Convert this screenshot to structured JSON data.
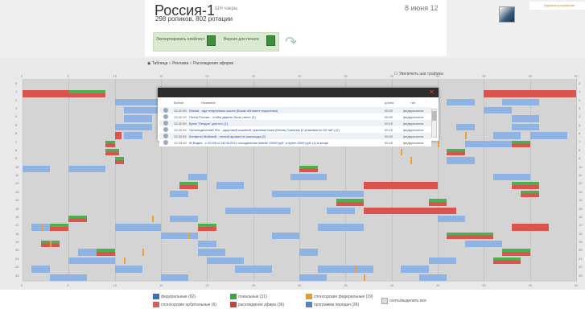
{
  "header": {
    "channel_title": "Россия-1",
    "channel_sup": "ШН чакры",
    "subtitle": "298 роликов, 802 ротации",
    "date": "8 июня  12",
    "export_label": "Экспортировать плейлист",
    "print_label": "Версия для печати",
    "admin_label": "Администрирование"
  },
  "view": {
    "option_table": "Таблица",
    "option_ads": "Реклама",
    "option_diverge": "Расхождения эфиров",
    "zoom_label": "Увеличить шаг графика"
  },
  "axis": {
    "ticks": [
      "0",
      "5",
      "10",
      "15",
      "20",
      "25",
      "30",
      "35",
      "40",
      "45",
      "50",
      "55",
      "60"
    ],
    "rows": [
      "0",
      "1",
      "2",
      "3",
      "4",
      "5",
      "6",
      "7",
      "8",
      "9",
      "10",
      "11",
      "12",
      "13",
      "14",
      "15",
      "16",
      "17",
      "18",
      "19",
      "20",
      "21",
      "22",
      "23"
    ]
  },
  "popup": {
    "headers": {
      "time": "Время",
      "title": "Название",
      "duration": "длина",
      "type": "тип"
    },
    "rows": [
      {
        "time": "12:31:59",
        "title": "Kitekat - еда энергичных кошек (Басик обгоняет поросенка)",
        "duration": "00:20",
        "type": "федеральное"
      },
      {
        "time": "12:32:19",
        "title": "Почта России - чтобы дарить было легче (2)",
        "duration": "00:20",
        "type": "федеральное"
      },
      {
        "time": "12:32:39",
        "title": "Крем \"Лендис\" для ног (1)",
        "duration": "00:10",
        "type": "федеральное"
      },
      {
        "time": "12:32:49",
        "title": "Ортопедический Яго - здоровый кошачий, красивая кожа (Месяц Граната) (2 упаковки по 60 таб.) (2)",
        "duration": "00:15",
        "type": "федеральное"
      },
      {
        "time": "12:32:59",
        "title": "Конфеты Майский - легкий аромат из шоколада (2)",
        "duration": "00:20",
        "type": "федеральное"
      },
      {
        "time": "12:33:19",
        "title": "Ж.Видео - с 29.05 по 18.06.2012 холодильник Indesit 12990 руб. и купон 3000 руб. (1) в конце",
        "duration": "00:15",
        "type": "федеральное"
      }
    ]
  },
  "legend": {
    "federal": "федеральные (62)",
    "local": "локальные (31)",
    "sponsor_fed": "спонсорские федеральные (19)",
    "sponsor_orb": "спонсорские орбитальные (6)",
    "diverge": "расхождения эфира (36)",
    "program": "программа передач (28)",
    "toggle_all": "снять/выделить все"
  },
  "colors": {
    "federal": "#8fb4e3",
    "local": "#4caf50",
    "sponsor_fed": "#f0a030",
    "sponsor_orb": "#e06060",
    "diverge": "#d9534f",
    "program": "#6a8fd9"
  },
  "chart_data": {
    "type": "timeline-grid",
    "rows": 24,
    "minutes": 60,
    "bars": [
      {
        "row": 1,
        "start": 0,
        "len": 5,
        "kind": "diverge"
      },
      {
        "row": 1,
        "start": 5,
        "len": 4,
        "kind": "combo"
      },
      {
        "row": 1,
        "start": 50,
        "len": 10,
        "kind": "diverge"
      },
      {
        "row": 2,
        "start": 10,
        "len": 5,
        "kind": "federal"
      },
      {
        "row": 2,
        "start": 18,
        "len": 4,
        "kind": "federal"
      },
      {
        "row": 2,
        "start": 30,
        "len": 5,
        "kind": "federal"
      },
      {
        "row": 2,
        "start": 46,
        "len": 3,
        "kind": "federal"
      },
      {
        "row": 2,
        "start": 52,
        "len": 4,
        "kind": "federal"
      },
      {
        "row": 3,
        "start": 11,
        "len": 4,
        "kind": "federal"
      },
      {
        "row": 3,
        "start": 50,
        "len": 3,
        "kind": "federal"
      },
      {
        "row": 4,
        "start": 11,
        "len": 3,
        "kind": "federal"
      },
      {
        "row": 4,
        "start": 53,
        "len": 3,
        "kind": "federal"
      },
      {
        "row": 5,
        "start": 10,
        "len": 4,
        "kind": "federal"
      },
      {
        "row": 5,
        "start": 47,
        "len": 2,
        "kind": "federal"
      },
      {
        "row": 5,
        "start": 53,
        "len": 3,
        "kind": "federal"
      },
      {
        "row": 6,
        "start": 11,
        "len": 2,
        "kind": "federal"
      },
      {
        "row": 6,
        "start": 10,
        "len": 0.7,
        "kind": "diverge"
      },
      {
        "row": 6,
        "start": 51,
        "len": 3,
        "kind": "federal"
      },
      {
        "row": 6,
        "start": 55,
        "len": 4,
        "kind": "federal"
      },
      {
        "row": 7,
        "start": 9,
        "len": 1,
        "kind": "combo"
      },
      {
        "row": 7,
        "start": 48,
        "len": 5,
        "kind": "federal"
      },
      {
        "row": 7,
        "start": 53,
        "len": 2,
        "kind": "combo"
      },
      {
        "row": 8,
        "start": 9,
        "len": 1.5,
        "kind": "combo"
      },
      {
        "row": 8,
        "start": 46,
        "len": 2,
        "kind": "combo"
      },
      {
        "row": 9,
        "start": 10,
        "len": 1,
        "kind": "combo"
      },
      {
        "row": 9,
        "start": 46,
        "len": 3,
        "kind": "federal"
      },
      {
        "row": 10,
        "start": 0,
        "len": 3,
        "kind": "federal"
      },
      {
        "row": 10,
        "start": 5,
        "len": 4,
        "kind": "federal"
      },
      {
        "row": 10,
        "start": 30,
        "len": 2,
        "kind": "combo"
      },
      {
        "row": 11,
        "start": 18,
        "len": 2,
        "kind": "federal"
      },
      {
        "row": 11,
        "start": 29,
        "len": 4,
        "kind": "federal"
      },
      {
        "row": 11,
        "start": 51,
        "len": 4,
        "kind": "federal"
      },
      {
        "row": 12,
        "start": 17,
        "len": 2,
        "kind": "combo"
      },
      {
        "row": 12,
        "start": 21,
        "len": 3,
        "kind": "federal"
      },
      {
        "row": 12,
        "start": 37,
        "len": 8,
        "kind": "diverge"
      },
      {
        "row": 12,
        "start": 53,
        "len": 3,
        "kind": "combo"
      },
      {
        "row": 13,
        "start": 16,
        "len": 2,
        "kind": "federal"
      },
      {
        "row": 13,
        "start": 27,
        "len": 4,
        "kind": "federal"
      },
      {
        "row": 13,
        "start": 31,
        "len": 6,
        "kind": "federal"
      },
      {
        "row": 13,
        "start": 54,
        "len": 2,
        "kind": "combo"
      },
      {
        "row": 14,
        "start": 34,
        "len": 3,
        "kind": "combo"
      },
      {
        "row": 14,
        "start": 44,
        "len": 2,
        "kind": "combo"
      },
      {
        "row": 15,
        "start": 22,
        "len": 7,
        "kind": "federal"
      },
      {
        "row": 15,
        "start": 33,
        "len": 3,
        "kind": "federal"
      },
      {
        "row": 15,
        "start": 37,
        "len": 10,
        "kind": "diverge"
      },
      {
        "row": 16,
        "start": 5,
        "len": 2,
        "kind": "combo"
      },
      {
        "row": 16,
        "start": 16,
        "len": 3,
        "kind": "federal"
      },
      {
        "row": 16,
        "start": 45,
        "len": 3,
        "kind": "federal"
      },
      {
        "row": 17,
        "start": 1,
        "len": 2,
        "kind": "federal"
      },
      {
        "row": 17,
        "start": 3,
        "len": 2,
        "kind": "combo"
      },
      {
        "row": 17,
        "start": 10,
        "len": 5,
        "kind": "federal"
      },
      {
        "row": 17,
        "start": 19,
        "len": 2,
        "kind": "combo"
      },
      {
        "row": 17,
        "start": 32,
        "len": 5,
        "kind": "federal"
      },
      {
        "row": 17,
        "start": 53,
        "len": 4,
        "kind": "diverge"
      },
      {
        "row": 18,
        "start": 15,
        "len": 4,
        "kind": "federal"
      },
      {
        "row": 18,
        "start": 27,
        "len": 3,
        "kind": "federal"
      },
      {
        "row": 18,
        "start": 46,
        "len": 5,
        "kind": "combo"
      },
      {
        "row": 19,
        "start": 2,
        "len": 2,
        "kind": "combo"
      },
      {
        "row": 19,
        "start": 19,
        "len": 2,
        "kind": "federal"
      },
      {
        "row": 19,
        "start": 48,
        "len": 4,
        "kind": "federal"
      },
      {
        "row": 20,
        "start": 6,
        "len": 2,
        "kind": "federal"
      },
      {
        "row": 20,
        "start": 8,
        "len": 2,
        "kind": "combo"
      },
      {
        "row": 20,
        "start": 19,
        "len": 3,
        "kind": "federal"
      },
      {
        "row": 20,
        "start": 30,
        "len": 2,
        "kind": "federal"
      },
      {
        "row": 20,
        "start": 52,
        "len": 3,
        "kind": "combo"
      },
      {
        "row": 21,
        "start": 5,
        "len": 5,
        "kind": "federal"
      },
      {
        "row": 21,
        "start": 20,
        "len": 4,
        "kind": "federal"
      },
      {
        "row": 21,
        "start": 44,
        "len": 3,
        "kind": "federal"
      },
      {
        "row": 21,
        "start": 51,
        "len": 3,
        "kind": "combo"
      },
      {
        "row": 22,
        "start": 1,
        "len": 2,
        "kind": "federal"
      },
      {
        "row": 22,
        "start": 10,
        "len": 3,
        "kind": "federal"
      },
      {
        "row": 22,
        "start": 23,
        "len": 4,
        "kind": "federal"
      },
      {
        "row": 22,
        "start": 32,
        "len": 6,
        "kind": "federal"
      },
      {
        "row": 22,
        "start": 41,
        "len": 3,
        "kind": "federal"
      },
      {
        "row": 23,
        "start": 3,
        "len": 4,
        "kind": "federal"
      },
      {
        "row": 23,
        "start": 15,
        "len": 3,
        "kind": "federal"
      },
      {
        "row": 23,
        "start": 30,
        "len": 3,
        "kind": "federal"
      },
      {
        "row": 23,
        "start": 43,
        "len": 3,
        "kind": "federal"
      }
    ],
    "markers": [
      {
        "row": 6,
        "minute": 48
      },
      {
        "row": 7,
        "minute": 45
      },
      {
        "row": 8,
        "minute": 41
      },
      {
        "row": 9,
        "minute": 42
      },
      {
        "row": 16,
        "minute": 14
      },
      {
        "row": 17,
        "minute": 2
      },
      {
        "row": 18,
        "minute": 18
      },
      {
        "row": 19,
        "minute": 3
      },
      {
        "row": 20,
        "minute": 13
      },
      {
        "row": 21,
        "minute": 11
      },
      {
        "row": 22,
        "minute": 36
      },
      {
        "row": 23,
        "minute": 37
      }
    ]
  }
}
